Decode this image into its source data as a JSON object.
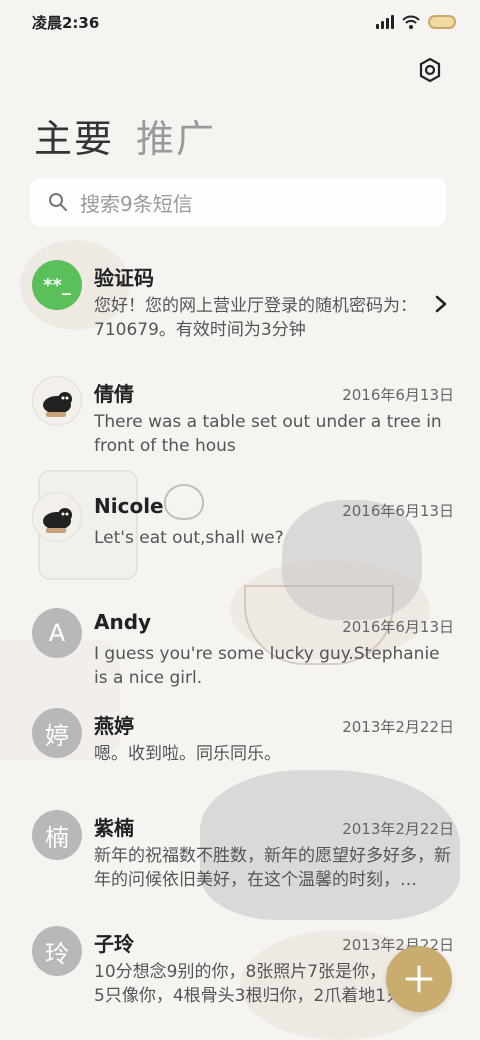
{
  "status_bar": {
    "time": "凌晨2:36"
  },
  "tabs": [
    {
      "label": "主要",
      "active": true
    },
    {
      "label": "推广",
      "active": false
    }
  ],
  "search": {
    "placeholder": "搜索9条短信"
  },
  "messages": [
    {
      "name": "验证码",
      "date": "",
      "preview": "您好！您的网上营业厅登录的随机密码为：710679。有效时间为3分钟",
      "avatar_text": "**_",
      "avatar_style": "green"
    },
    {
      "name": "倩倩",
      "date": "2016年6月13日",
      "preview": "There was a table set out under a tree in front of the hous",
      "avatar_text": "",
      "avatar_style": "photo"
    },
    {
      "name": "Nicole",
      "date": "2016年6月13日",
      "preview": "Let's eat out,shall we?",
      "avatar_text": "",
      "avatar_style": "photo"
    },
    {
      "name": "Andy",
      "date": "2016年6月13日",
      "preview": "I guess you're some lucky guy.Stephanie is a nice girl.",
      "avatar_text": "A",
      "avatar_style": "gray"
    },
    {
      "name": "燕婷",
      "date": "2013年2月22日",
      "preview": "嗯。收到啦。同乐同乐。",
      "avatar_text": "婷",
      "avatar_style": "gray"
    },
    {
      "name": "紫楠",
      "date": "2013年2月22日",
      "preview": "新年的祝福数不胜数，新年的愿望好多好多，新年的问候依旧美好，在这个温馨的时刻，…",
      "avatar_text": "楠",
      "avatar_style": "gray"
    },
    {
      "name": "子玲",
      "date": "2013年2月22日",
      "preview": "10分想念9别的你，8张照片7张是你，6张笑脸5只像你，4根骨头3根归你，2爪着地1只…",
      "avatar_text": "玲",
      "avatar_style": "gray"
    }
  ],
  "colors": {
    "accent": "#c9ad6e",
    "green_avatar": "#5cc05a",
    "gray_avatar": "#b8b8b8"
  }
}
